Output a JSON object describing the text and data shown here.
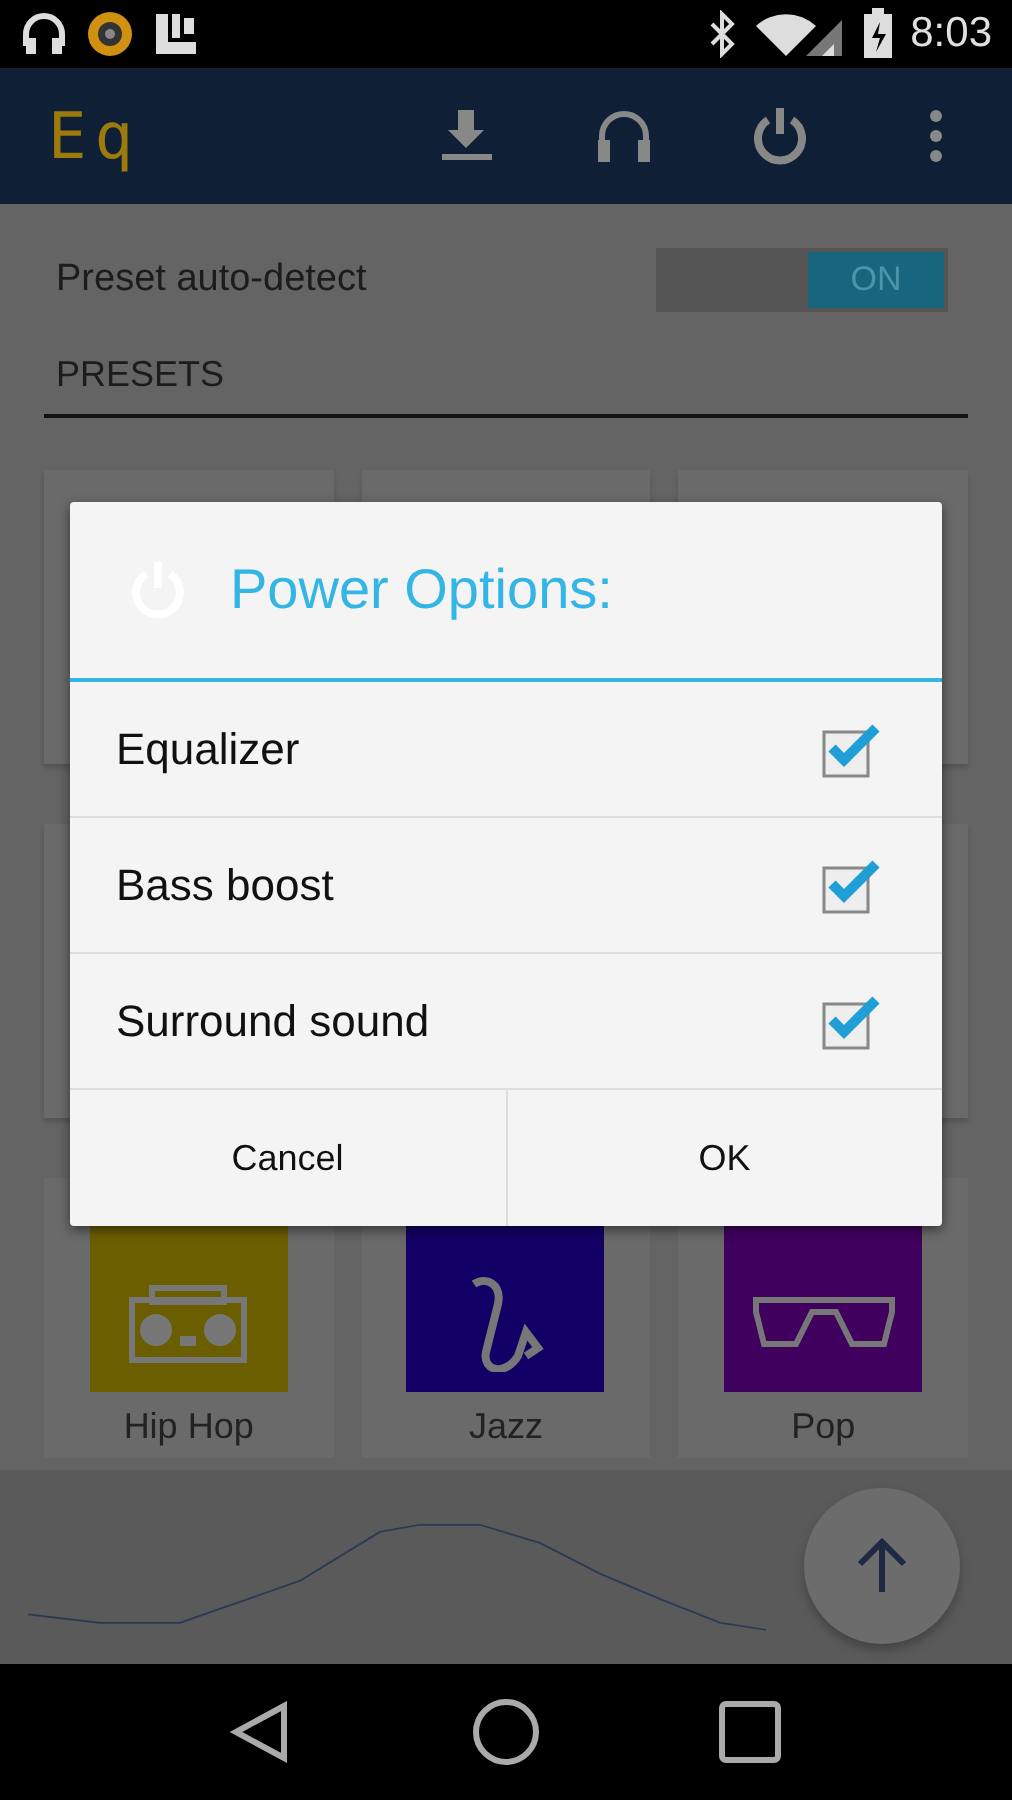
{
  "status_bar": {
    "time": "8:03"
  },
  "app_bar": {
    "title": "Eq"
  },
  "auto_detect": {
    "label": "Preset auto-detect",
    "toggle_text": "ON",
    "on": true
  },
  "section_title": "PRESETS",
  "presets": [
    {
      "name": "Hip Hop",
      "color": "#6b5e00"
    },
    {
      "name": "Jazz",
      "color": "#130066"
    },
    {
      "name": "Pop",
      "color": "#40005e"
    }
  ],
  "dialog": {
    "title": "Power Options:",
    "options": [
      {
        "label": "Equalizer",
        "checked": true
      },
      {
        "label": "Bass boost",
        "checked": true
      },
      {
        "label": "Surround sound",
        "checked": true
      }
    ],
    "buttons": [
      "Cancel",
      "OK"
    ]
  }
}
